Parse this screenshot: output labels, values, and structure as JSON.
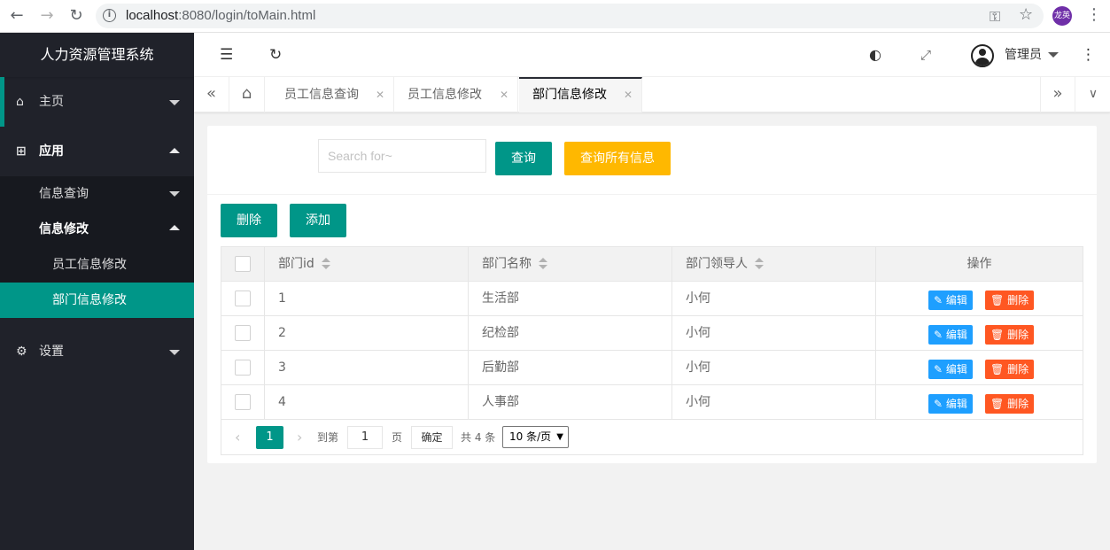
{
  "browser": {
    "url_host": "localhost",
    "url_rest": ":8080/login/toMain.html",
    "profile_label": "龙英"
  },
  "sidebar": {
    "logo": "人力资源管理系统",
    "items": [
      {
        "label": "主页"
      },
      {
        "label": "应用"
      },
      {
        "label": "设置"
      }
    ],
    "sub_items": [
      {
        "label": "信息查询"
      },
      {
        "label": "信息修改"
      }
    ],
    "subsub_items": [
      {
        "label": "员工信息修改"
      },
      {
        "label": "部门信息修改"
      }
    ]
  },
  "header": {
    "user_name": "管理员"
  },
  "tabs": [
    {
      "label": "员工信息查询"
    },
    {
      "label": "员工信息修改"
    },
    {
      "label": "部门信息修改"
    }
  ],
  "search": {
    "placeholder": "Search for~",
    "query_label": "查询",
    "query_all_label": "查询所有信息"
  },
  "toolbar": {
    "delete_label": "删除",
    "add_label": "添加"
  },
  "table": {
    "columns": [
      "部门id",
      "部门名称",
      "部门领导人",
      "操作"
    ],
    "rows": [
      {
        "id": "1",
        "name": "生活部",
        "leader": "小何"
      },
      {
        "id": "2",
        "name": "纪检部",
        "leader": "小何"
      },
      {
        "id": "3",
        "name": "后勤部",
        "leader": "小何"
      },
      {
        "id": "4",
        "name": "人事部",
        "leader": "小何"
      }
    ],
    "edit_label": "编辑",
    "delete_label": "删除"
  },
  "pagination": {
    "current_page": "1",
    "goto_label": "到第",
    "page_input_value": "1",
    "page_unit": "页",
    "confirm_label": "确定",
    "total_label": "共 4 条",
    "page_size_selected": "10 条/页"
  },
  "colors": {
    "accent": "#009688",
    "warn": "#ffb800",
    "edit": "#1e9fff",
    "danger": "#ff5722",
    "sidebar_bg": "#20222a"
  }
}
